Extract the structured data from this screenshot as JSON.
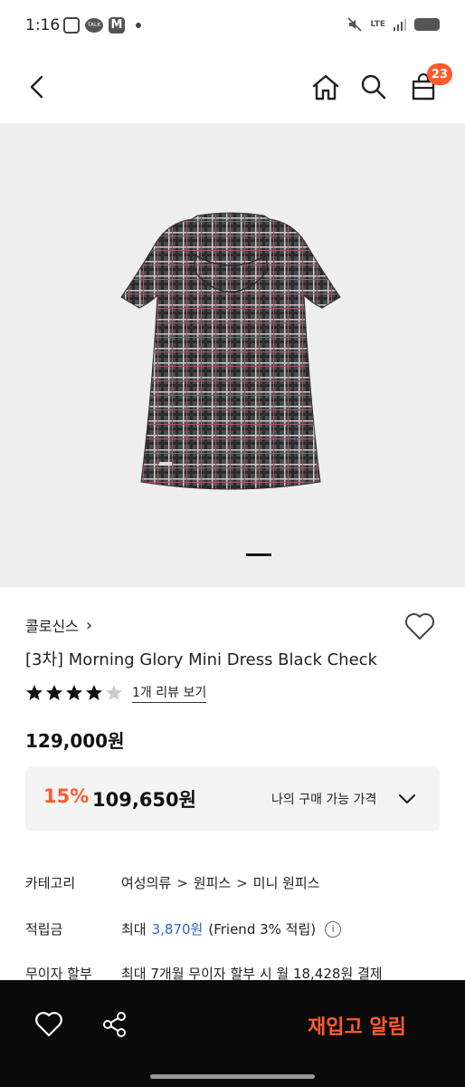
{
  "status_bar": {
    "time": "1:16",
    "talk_icon_text": "TALK",
    "mail_icon_text": "M",
    "network": "LTE"
  },
  "header": {
    "cart_count": "23",
    "icons": [
      "back-arrow-icon",
      "home-icon",
      "search-icon",
      "shopping-bag-icon"
    ]
  },
  "product": {
    "brand": "콜로신스",
    "brand_chevron": "›",
    "title": "[3차] Morning Glory Mini Dress Black Check",
    "rating_filled_stars": 4,
    "rating_total_stars": 5,
    "review_link": "1개 리뷰 보기",
    "list_price": "129,000원",
    "discount_percent": "15%",
    "sale_price": "109,650원",
    "my_price_label": "나의 구매 가능 가격"
  },
  "details": {
    "category_label": "카테고리",
    "category_path": [
      "여성의류",
      "원피스",
      "미니 원피스"
    ],
    "category_separator": ">",
    "points_label": "적립금",
    "points_prefix": "최대",
    "points_amount": "3,870원",
    "points_suffix": "(Friend 3% 적립)",
    "points_info_icon": "i",
    "installment_label": "무이자 할부",
    "installment_text": "최대 7개월 무이자 할부 시 월 18,428원 결제"
  },
  "bottom_bar": {
    "restock_label": "재입고 알림"
  },
  "colors": {
    "accent": "#ff5a2d",
    "link_blue": "#2f64c8",
    "bottom_bar_bg": "#0a0a0a",
    "image_bg": "#eeeeee"
  }
}
